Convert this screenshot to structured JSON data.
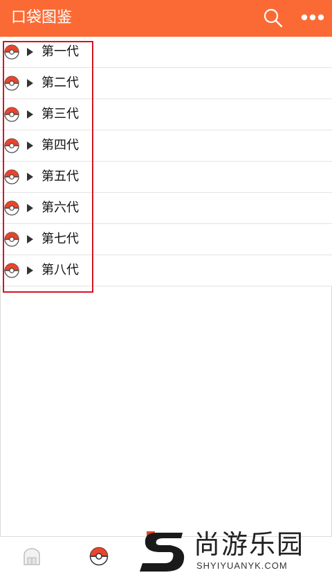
{
  "header": {
    "title": "口袋图鉴",
    "search_icon": "search-icon",
    "more_icon": "more-dots-icon",
    "bg_color": "#fb6a35"
  },
  "generations": [
    {
      "label": "第一代"
    },
    {
      "label": "第二代"
    },
    {
      "label": "第三代"
    },
    {
      "label": "第四代"
    },
    {
      "label": "第五代"
    },
    {
      "label": "第六代"
    },
    {
      "label": "第七代"
    },
    {
      "label": "第八代"
    }
  ],
  "row_icon": "pokeball-icon",
  "row_expand_icon": "triangle-right-icon",
  "highlight_color": "#d6131f",
  "bottom_nav": [
    {
      "icon": "home-icon"
    },
    {
      "icon": "pokeball-icon"
    }
  ],
  "watermark": {
    "cn": "尚游乐园",
    "en": "SHYIYUANYK.COM"
  }
}
